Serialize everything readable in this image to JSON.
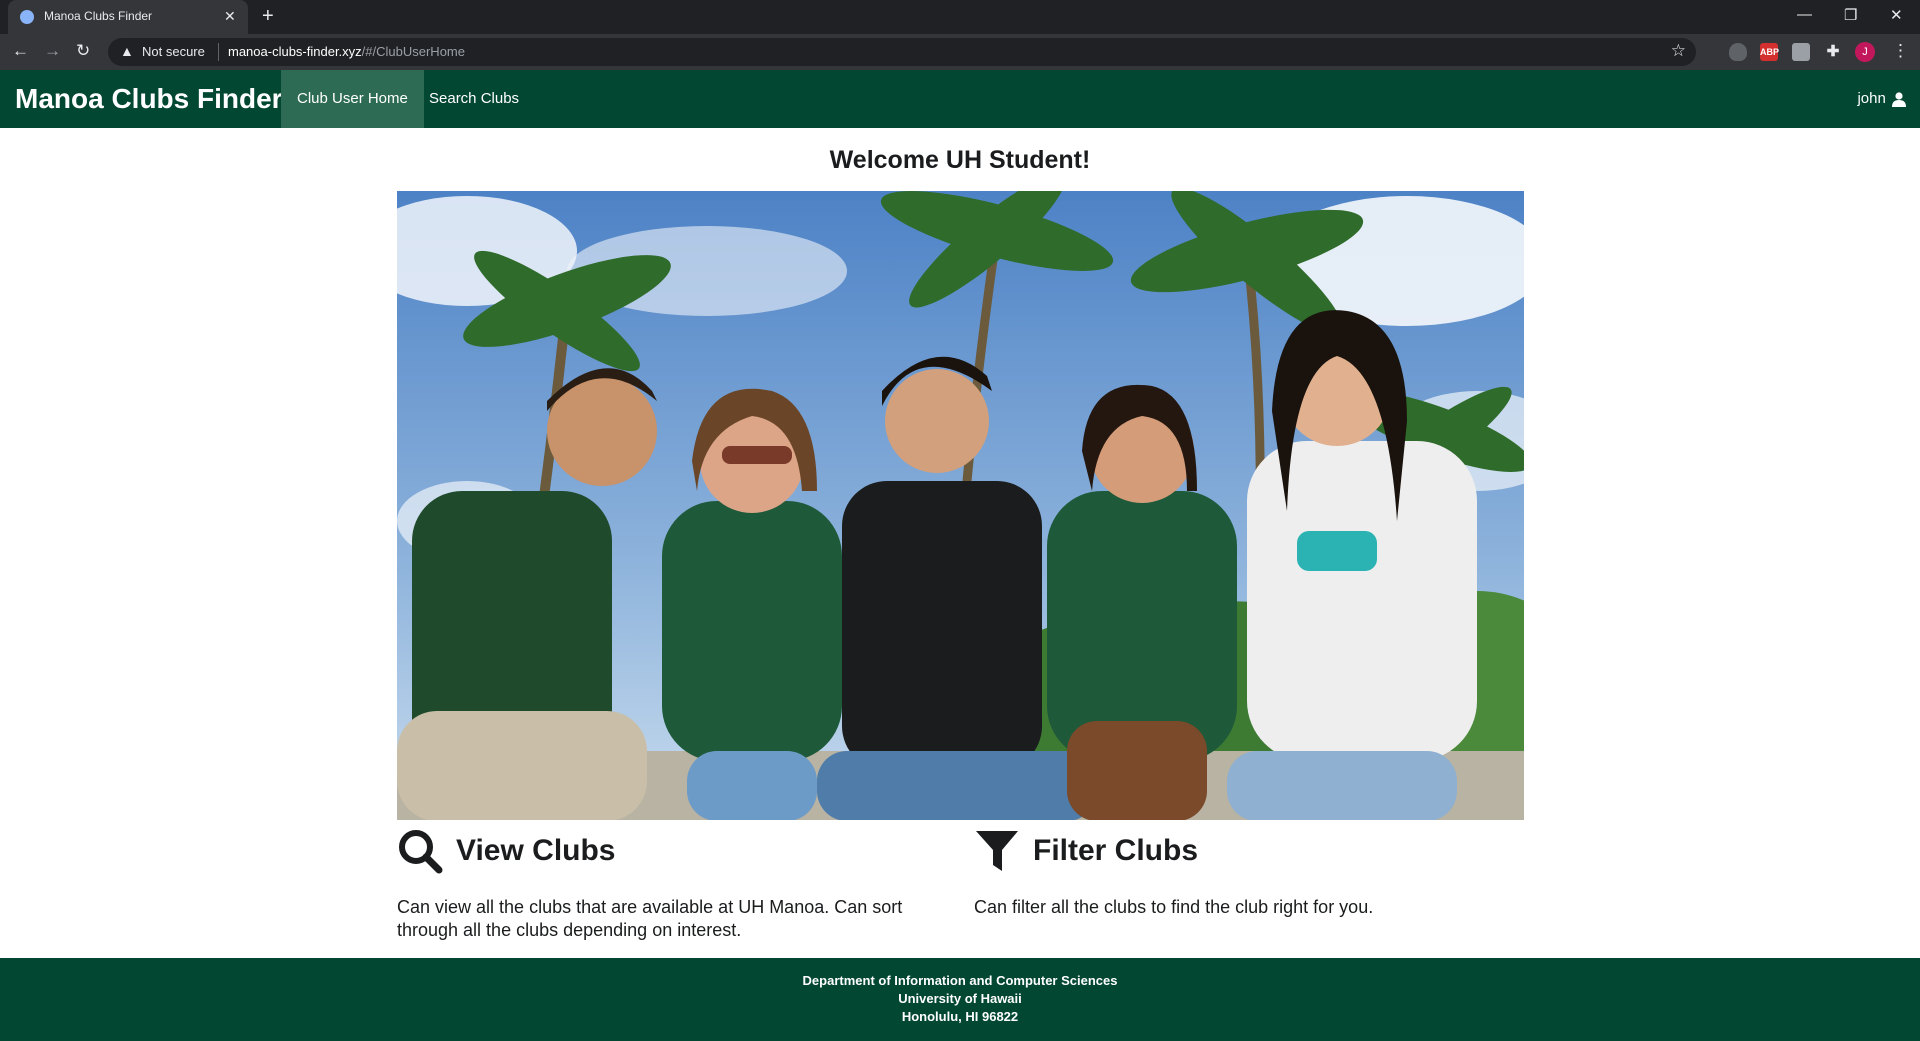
{
  "browser": {
    "tab_title": "Manoa Clubs Finder",
    "security_label": "Not secure",
    "url_host": "manoa-clubs-finder.xyz",
    "url_path": "/#/ClubUserHome",
    "extensions": [
      "shield-extension",
      "adblock-extension",
      "translate-extension",
      "extensions-puzzle"
    ],
    "adblock_label": "ABP",
    "profile_initial": "J"
  },
  "navbar": {
    "brand": "Manoa Clubs Finder",
    "items": [
      {
        "label": "Club User Home",
        "active": true
      },
      {
        "label": "Search Clubs",
        "active": false
      }
    ],
    "user": "john",
    "background_color": "#024731",
    "active_color": "#2d6b55"
  },
  "main": {
    "welcome": "Welcome UH Student!",
    "hero_image": "group of five smiling students in Hawaii shirts under palm trees",
    "features": [
      {
        "icon": "search-icon",
        "title": "View Clubs",
        "text": "Can view all the clubs that are available at UH Manoa. Can sort through all the clubs depending on interest."
      },
      {
        "icon": "filter-icon",
        "title": "Filter Clubs",
        "text": "Can filter all the clubs to find the club right for you."
      }
    ]
  },
  "footer": {
    "lines": [
      "Department of Information and Computer Sciences",
      "University of Hawaii",
      "Honolulu, HI 96822"
    ]
  }
}
